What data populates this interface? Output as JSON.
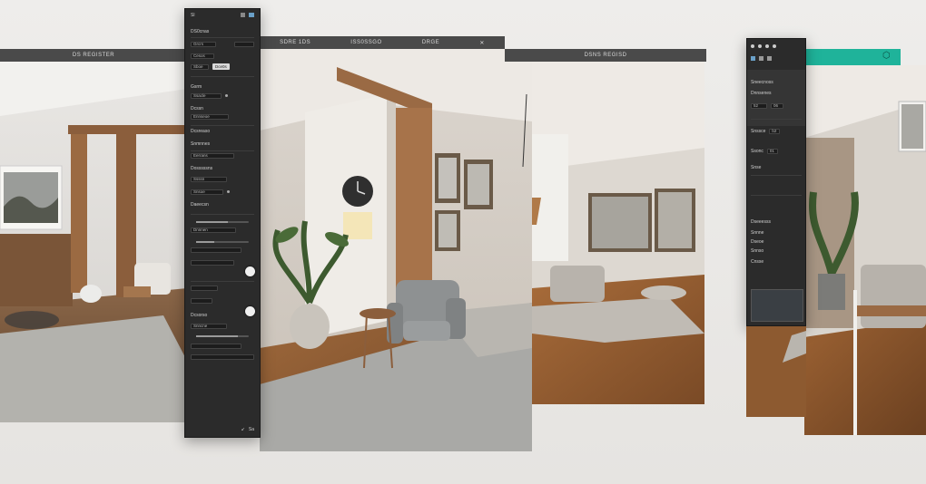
{
  "left_window": {
    "title": "DS REGISTER"
  },
  "center_window": {
    "tabs": [
      "SDRE 1DS",
      "ISS0SSGO",
      "DRGE"
    ],
    "close": "✕"
  },
  "right_window": {
    "title": "DSNS REGISD"
  },
  "tool_panel": {
    "header": "Sl",
    "section_title": "DS0cnas",
    "field_1_label": "Grcrs",
    "field_1_value": "Cesos",
    "field_2_value": "Sboe",
    "field_3_label": "Gsrm",
    "button_1": "Dce0s",
    "row_labels": [
      "Ssacle",
      "Dcssn",
      "Ennseoe",
      "Dcsreaso",
      "Snmnnes",
      "Eerrans",
      "Dosssssns",
      "Ssssn",
      "Snsoe",
      "Daeecsn",
      "Dnnnen"
    ],
    "slider_1": 0.6,
    "slider_2": 0.35,
    "slider_3": 0.8,
    "toggle_on": true,
    "footer_a": "Dcsorso",
    "footer_b": "Snncne",
    "footer_values": [
      "↙",
      "Sa"
    ]
  },
  "right_panel": {
    "header": "Sneecnoss",
    "rows": [
      "Dnnsenes",
      "Snssce",
      "Ssonc",
      "Snse"
    ],
    "values": [
      "52",
      "06",
      "b2",
      "01"
    ],
    "list_labels": [
      "Dseeesss",
      "Snnne",
      "Dseoe",
      "Snnso",
      "Cnsse"
    ],
    "accent": "#1fb39a",
    "toolbar_glyph": "⬡"
  },
  "colors": {
    "panel_bg": "#2b2b2b",
    "bar_bg": "#4a4a4a",
    "teal": "#1fb39a"
  }
}
